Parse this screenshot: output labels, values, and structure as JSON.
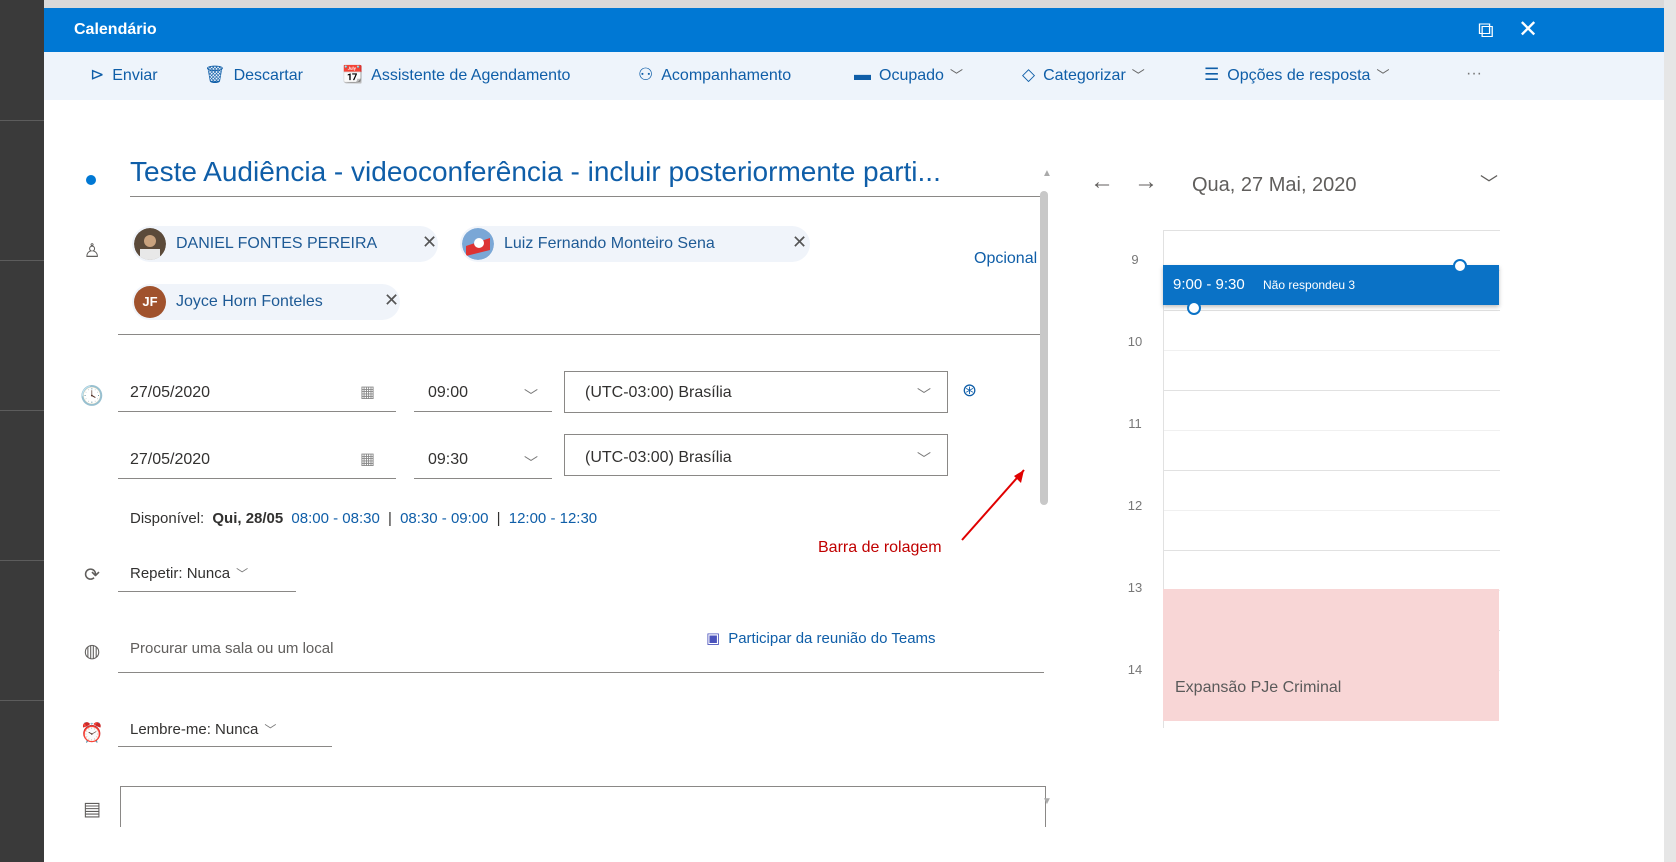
{
  "window": {
    "title": "Calendário",
    "popout_icon": "popout-icon",
    "close_icon": "close-icon"
  },
  "toolbar": {
    "send": "Enviar",
    "discard": "Descartar",
    "scheduling_assistant": "Assistente de Agendamento",
    "tracking": "Acompanhamento",
    "busy": "Ocupado",
    "categorize": "Categorizar",
    "response_options": "Opções de resposta",
    "more": "···"
  },
  "event": {
    "subject": "Teste Audiência - videoconferência - incluir posteriormente parti...",
    "attendees": [
      {
        "name": "DANIEL FONTES PEREIRA"
      },
      {
        "name": "Luiz Fernando Monteiro Sena"
      },
      {
        "name": "Joyce Horn Fonteles",
        "initials": "JF"
      }
    ],
    "optional_label": "Opcional",
    "start_date": "27/05/2020",
    "start_time": "09:00",
    "start_timezone": "(UTC-03:00) Brasília",
    "end_date": "27/05/2020",
    "end_time": "09:30",
    "end_timezone": "(UTC-03:00) Brasília",
    "available_label": "Disponível:",
    "available_day": "Qui, 28/05",
    "slots": [
      "08:00 - 08:30",
      "08:30 - 09:00",
      "12:00 - 12:30"
    ],
    "slot_separator": "|",
    "repeat": "Repetir: Nunca",
    "location_placeholder": "Procurar uma sala ou um local",
    "teams_link": "Participar da reunião do Teams",
    "reminder": "Lembre-me: Nunca"
  },
  "annotation": "Barra de rolagem",
  "calendar": {
    "date": "Qua, 27 Mai, 2020",
    "hours": [
      "9",
      "10",
      "11",
      "12",
      "13",
      "14"
    ],
    "event_time": "9:00 - 9:30",
    "event_status": "Não respondeu 3",
    "busy_event": "Expansão PJe Criminal"
  },
  "colors": {
    "accent": "#0078d4",
    "link": "#0f5ea8",
    "busy": "#f8d6d6",
    "annotation": "#c00000"
  }
}
